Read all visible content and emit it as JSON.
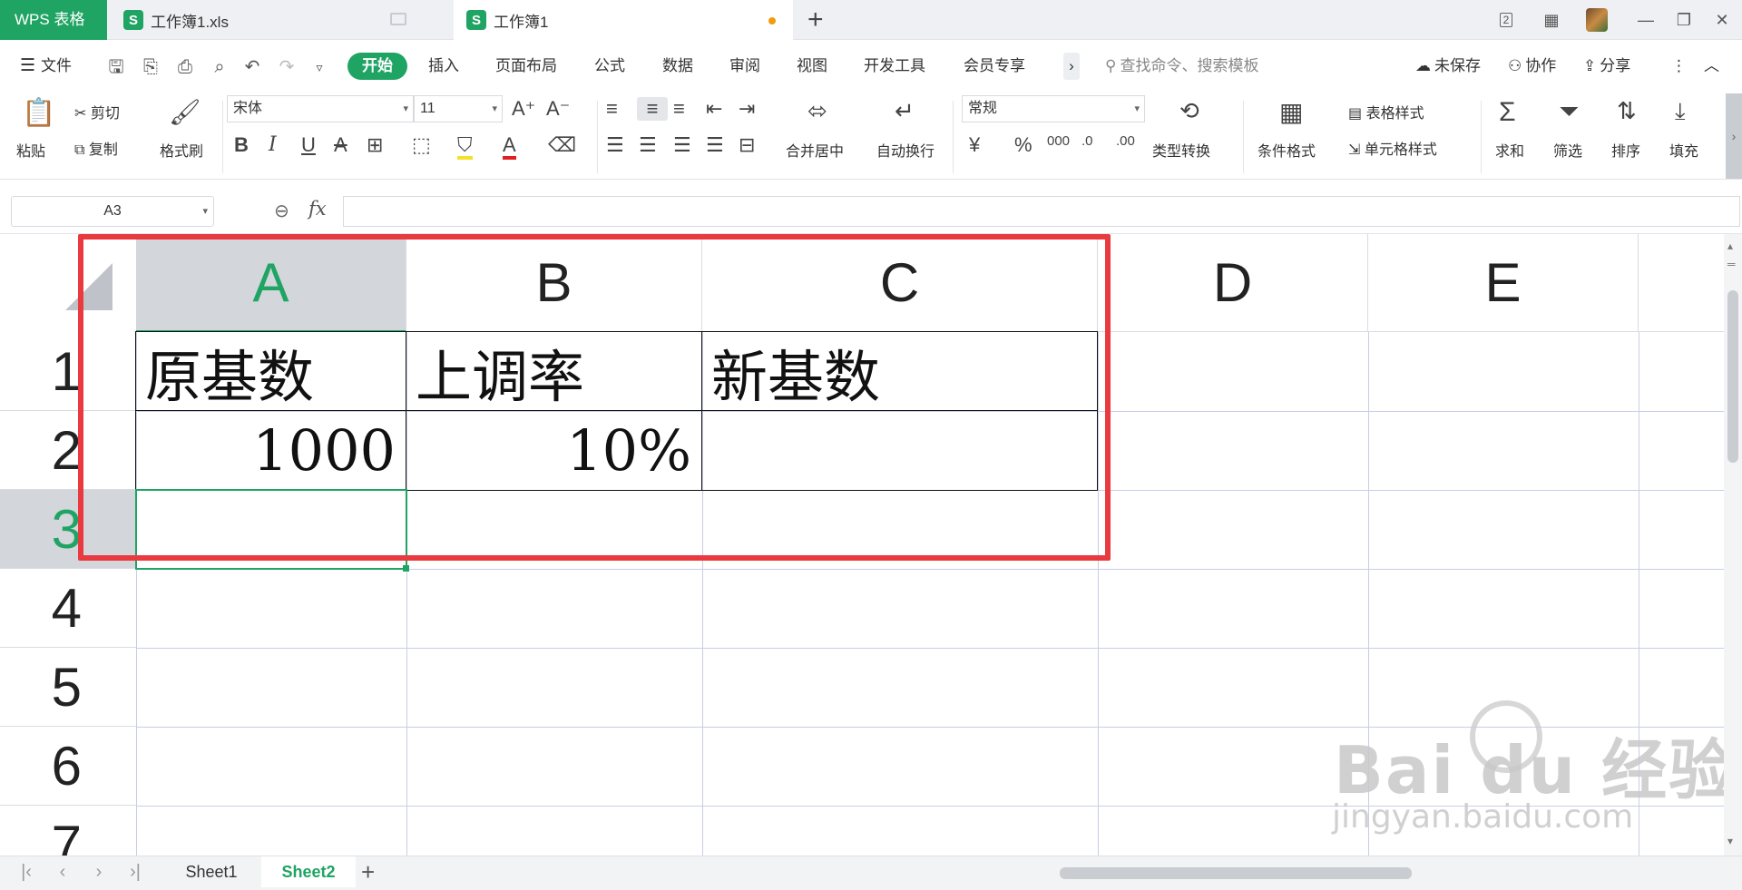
{
  "tabs": {
    "app": "WPS 表格",
    "doc1": "工作簿1.xls",
    "doc2": "工作簿1",
    "add": "+"
  },
  "window": {
    "badge": "2",
    "minimize": "—",
    "restore": "❐",
    "close": "✕"
  },
  "menu": {
    "file": "文件",
    "items": [
      "开始",
      "插入",
      "页面布局",
      "公式",
      "数据",
      "审阅",
      "视图",
      "开发工具",
      "会员专享"
    ],
    "more": "›",
    "search_placeholder": "查找命令、搜索模板",
    "unsaved": "未保存",
    "collab": "协作",
    "share": "分享"
  },
  "ribbon": {
    "paste": "粘贴",
    "cut": "剪切",
    "copy": "复制",
    "format_painter": "格式刷",
    "font_name": "宋体",
    "font_size": "11",
    "merge_center": "合并居中",
    "wrap_text": "自动换行",
    "number_format": "常规",
    "type_convert": "类型转换",
    "conditional_format": "条件格式",
    "table_style": "表格样式",
    "cell_style": "单元格样式",
    "sum": "求和",
    "filter": "筛选",
    "sort": "排序",
    "fill": "填充"
  },
  "formula_bar": {
    "name_box": "A3",
    "fx": "fx",
    "formula": ""
  },
  "sheet": {
    "columns": [
      "A",
      "B",
      "C",
      "D",
      "E"
    ],
    "rows": [
      "1",
      "2",
      "3",
      "4",
      "5",
      "6",
      "7"
    ],
    "cells": {
      "A1": "原基数",
      "B1": "上调率",
      "C1": "新基数",
      "A2": "1000",
      "B2": "10%",
      "C2": ""
    }
  },
  "sheet_tabs": [
    "Sheet1",
    "Sheet2"
  ],
  "watermark": {
    "brand": "Bai  du 经验",
    "url": "jingyan.baidu.com"
  },
  "colors": {
    "accent": "#1fa463",
    "annotation": "#e93a3f"
  }
}
